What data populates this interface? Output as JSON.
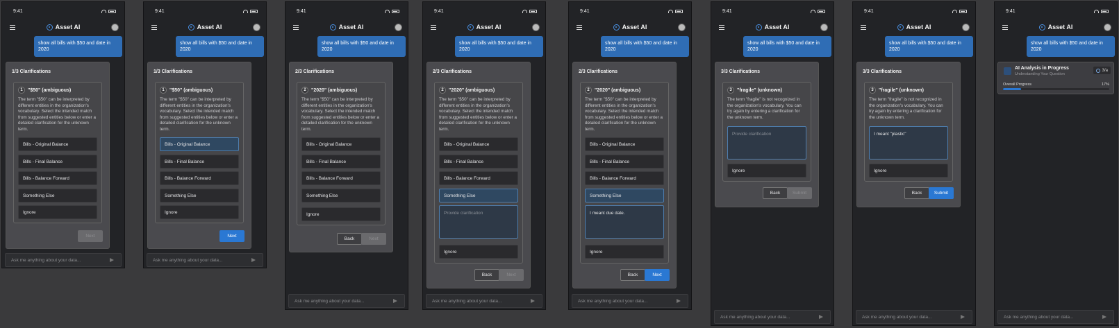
{
  "status_time": "9:41",
  "app_title": "Asset AI",
  "query": "show all bills with $50 and date in 2020",
  "ask_placeholder": "Ask me anything about your data...",
  "labels": {
    "next": "Next",
    "back": "Back",
    "submit": "Submit",
    "provide": "Provide clarification"
  },
  "q1": {
    "step": "1/3 Clarifications",
    "num": "1",
    "term": "\"$50\" (ambiguous)",
    "desc": "The term \"$50\" can be interpreted by different entities in the organization's vocabulary. Select the intended match from suggested entities below or enter a detailed clarification for the unknown term."
  },
  "q2": {
    "step": "2/3 Clarifications",
    "num": "2",
    "term": "\"2020\" (ambiguous)",
    "desc": "The term \"$50\" can be interpreted by different entities in the organization's vocabulary. Select the intended match from suggested entities below or enter a detailed clarification for the unknown term."
  },
  "q3": {
    "step": "3/3 Clarifications",
    "num": "3",
    "term": "\"fragile\" (unknown)",
    "desc": "The term \"fragile\" is not recognized in the organization's vocabulary. You can try again by entering a clarification for the unknown term."
  },
  "options": [
    "Bills - Original Balance",
    "Bills - Final Balance",
    "Bills - Balance Forward",
    "Something Else",
    "Ignore"
  ],
  "ignore": "Ignore",
  "clarif_due": "I meant due date.",
  "clarif_plastic": "I meant \"plastic\"",
  "ai": {
    "title": "AI Analysis in Progress",
    "subtitle": "Understanding Your Question",
    "badge": "3/a",
    "progress_label": "Overall Progress",
    "progress_text": "17%",
    "progress_value": 0.17
  },
  "colors": {
    "accent": "#2a78d3",
    "bubble": "#2f6db5"
  }
}
